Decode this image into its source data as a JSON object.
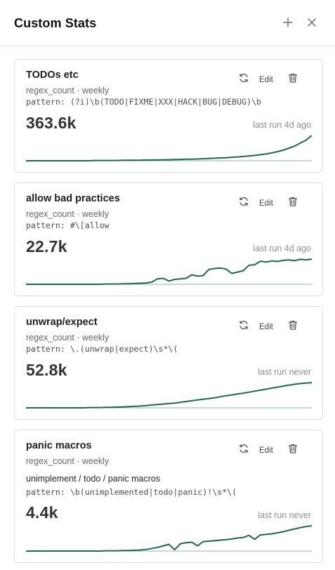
{
  "header": {
    "title": "Custom Stats",
    "add_icon": "plus-icon",
    "close_icon": "close-icon"
  },
  "colors": {
    "sparkline": "#1e6a48",
    "baseline": "#1e6a48",
    "border": "#d8dde3"
  },
  "cards": [
    {
      "name": "TODOs etc",
      "meta": "regex_count · weekly",
      "description": "",
      "pattern": "pattern: (?i)\\b(TODO|FIXME|XXX|HACK|BUG|DEBUG)\\b",
      "value": "363.6k",
      "last_run": "last run 4d ago",
      "edit_label": "Edit",
      "sparkline": [
        0,
        0,
        0,
        0,
        0,
        0,
        0,
        0,
        0,
        0,
        0,
        0,
        0.01,
        0.01,
        0.01,
        0.01,
        0.01,
        0.02,
        0.02,
        0.02,
        0.02,
        0.03,
        0.03,
        0.03,
        0.04,
        0.04,
        0.05,
        0.05,
        0.06,
        0.06,
        0.07,
        0.08,
        0.09,
        0.1,
        0.11,
        0.12,
        0.14,
        0.15,
        0.17,
        0.19,
        0.21,
        0.24,
        0.27,
        0.31,
        0.36,
        0.42,
        0.5,
        0.58,
        0.7,
        0.82,
        1.0
      ]
    },
    {
      "name": "allow bad practices",
      "meta": "regex_count · weekly",
      "description": "",
      "pattern": "pattern: #\\[allow",
      "value": "22.7k",
      "last_run": "last run 4d ago",
      "edit_label": "Edit",
      "sparkline": [
        0,
        0,
        0,
        0,
        0,
        0,
        0,
        0,
        0,
        0,
        0,
        0,
        0,
        0,
        0.01,
        0.01,
        0.01,
        0.02,
        0.02,
        0.03,
        0.04,
        0.05,
        0.08,
        0.2,
        0.22,
        0.12,
        0.18,
        0.2,
        0.22,
        0.35,
        0.3,
        0.32,
        0.55,
        0.58,
        0.6,
        0.56,
        0.4,
        0.45,
        0.5,
        0.7,
        0.72,
        0.85,
        0.82,
        0.86,
        0.84,
        0.88,
        0.9,
        0.87,
        0.92,
        0.9,
        0.93
      ]
    },
    {
      "name": "unwrap/expect",
      "meta": "regex_count · weekly",
      "description": "",
      "pattern": "pattern: \\.(unwrap|expect)\\s*\\(",
      "value": "52.8k",
      "last_run": "last run never",
      "edit_label": "Edit",
      "sparkline": [
        0,
        0,
        0,
        0,
        0,
        0,
        0,
        0,
        0,
        0,
        0,
        0.01,
        0.01,
        0.01,
        0.02,
        0.02,
        0.03,
        0.04,
        0.05,
        0.06,
        0.07,
        0.09,
        0.11,
        0.13,
        0.15,
        0.17,
        0.19,
        0.22,
        0.25,
        0.28,
        0.31,
        0.34,
        0.37,
        0.4,
        0.44,
        0.48,
        0.51,
        0.55,
        0.58,
        0.62,
        0.66,
        0.7,
        0.74,
        0.78,
        0.82,
        0.86,
        0.9,
        0.93,
        0.96,
        0.98,
        1.0
      ]
    },
    {
      "name": "panic macros",
      "meta": "regex_count · weekly",
      "description": "unimplement / todo / panic macros",
      "pattern": "pattern: \\b(unimplemented|todo|panic)!\\s*\\(",
      "value": "4.4k",
      "last_run": "last run never",
      "edit_label": "Edit",
      "sparkline": [
        0,
        0,
        0,
        0,
        0,
        0,
        0,
        0,
        0,
        0,
        0,
        0,
        0,
        0,
        0.01,
        0.01,
        0.01,
        0.02,
        0.02,
        0.03,
        0.04,
        0.06,
        0.1,
        0.14,
        0.2,
        0.26,
        0.05,
        0.28,
        0.32,
        0.34,
        0.2,
        0.36,
        0.38,
        0.4,
        0.42,
        0.44,
        0.46,
        0.5,
        0.52,
        0.6,
        0.45,
        0.62,
        0.64,
        0.66,
        0.7,
        0.74,
        0.8,
        0.85,
        0.9,
        0.94,
        0.97
      ]
    }
  ]
}
